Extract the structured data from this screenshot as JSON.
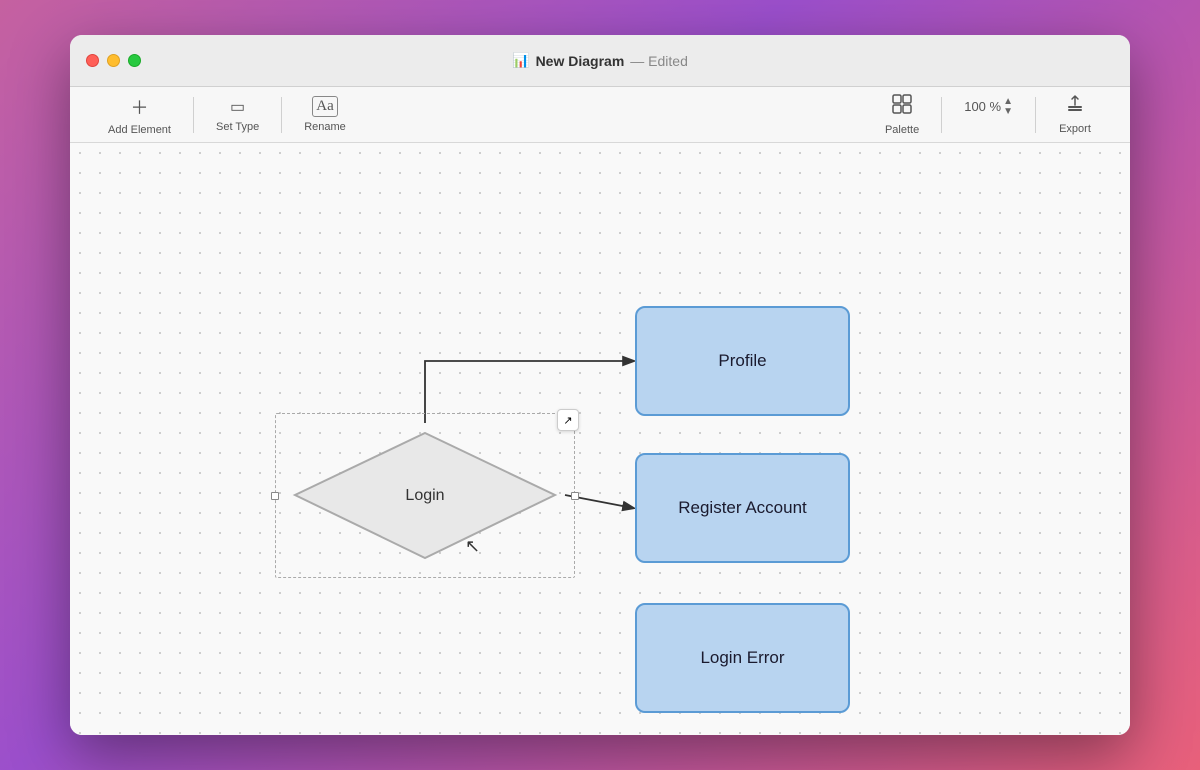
{
  "window": {
    "title": "New Diagram",
    "subtitle": "— Edited",
    "icon": "📊"
  },
  "toolbar": {
    "add_element_label": "Add Element",
    "set_type_label": "Set Type",
    "rename_label": "Rename",
    "palette_label": "Palette",
    "zoom_label": "100 %",
    "export_label": "Export",
    "add_icon": "+",
    "set_type_icon": "▭",
    "rename_icon": "Aa",
    "palette_icon": "⊞",
    "zoom_icon": "⌃",
    "export_icon": "↑□"
  },
  "diagram": {
    "diamond_label": "Login",
    "node_profile_label": "Profile",
    "node_register_label": "Register Account",
    "node_error_label": "Login Error"
  },
  "colors": {
    "node_fill": "#b8d4f0",
    "node_border": "#5b9bd5",
    "diamond_fill": "#e8e8e8",
    "diamond_stroke": "#aaaaaa",
    "arrow": "#333333"
  }
}
